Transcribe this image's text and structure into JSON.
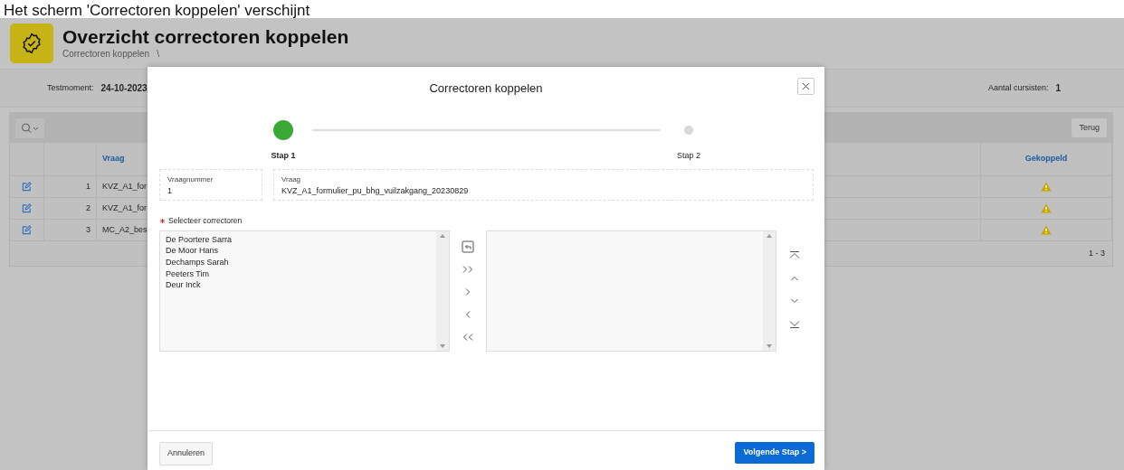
{
  "caption": "Het scherm 'Correctoren koppelen' verschijnt",
  "page": {
    "title": "Overzicht correctoren koppelen",
    "breadcrumb": "Correctoren koppelen",
    "breadcrumb_separator": "\\"
  },
  "info": [
    {
      "label": "Testmoment:",
      "value": "24-10-2023"
    },
    {
      "label": "Aantal cursisten:",
      "value": "1"
    }
  ],
  "report": {
    "button": "Terug",
    "columns": [
      "Vraag",
      "Gekoppeld"
    ],
    "rows": [
      {
        "number": "1",
        "vraag": "KVZ_A1_for",
        "linked": false
      },
      {
        "number": "2",
        "vraag": "KVZ_A1_for",
        "linked": false
      },
      {
        "number": "3",
        "vraag": "MC_A2_bes",
        "linked": false
      }
    ],
    "pagination": "1 - 3"
  },
  "dialog": {
    "title": "Correctoren koppelen",
    "steps": [
      {
        "label": "Stap 1",
        "selected": true
      },
      {
        "label": "Stap 2",
        "selected": false
      }
    ],
    "fields": [
      {
        "label": "Vraagnummer",
        "value": "1"
      },
      {
        "label": "Vraag",
        "value": "KVZ_A1_formulier_pu_bhg_vuilzakgang_20230829"
      }
    ],
    "shuttle": {
      "label": "Selecteer correctoren",
      "required": true,
      "available": [
        "De Poortere Sarra",
        "De Moor Hans",
        "Dechamps Sarah",
        "Peeters Tim",
        "Deur Inck"
      ]
    },
    "cancel": "Annuleren",
    "next": "Volgende Stap >"
  }
}
